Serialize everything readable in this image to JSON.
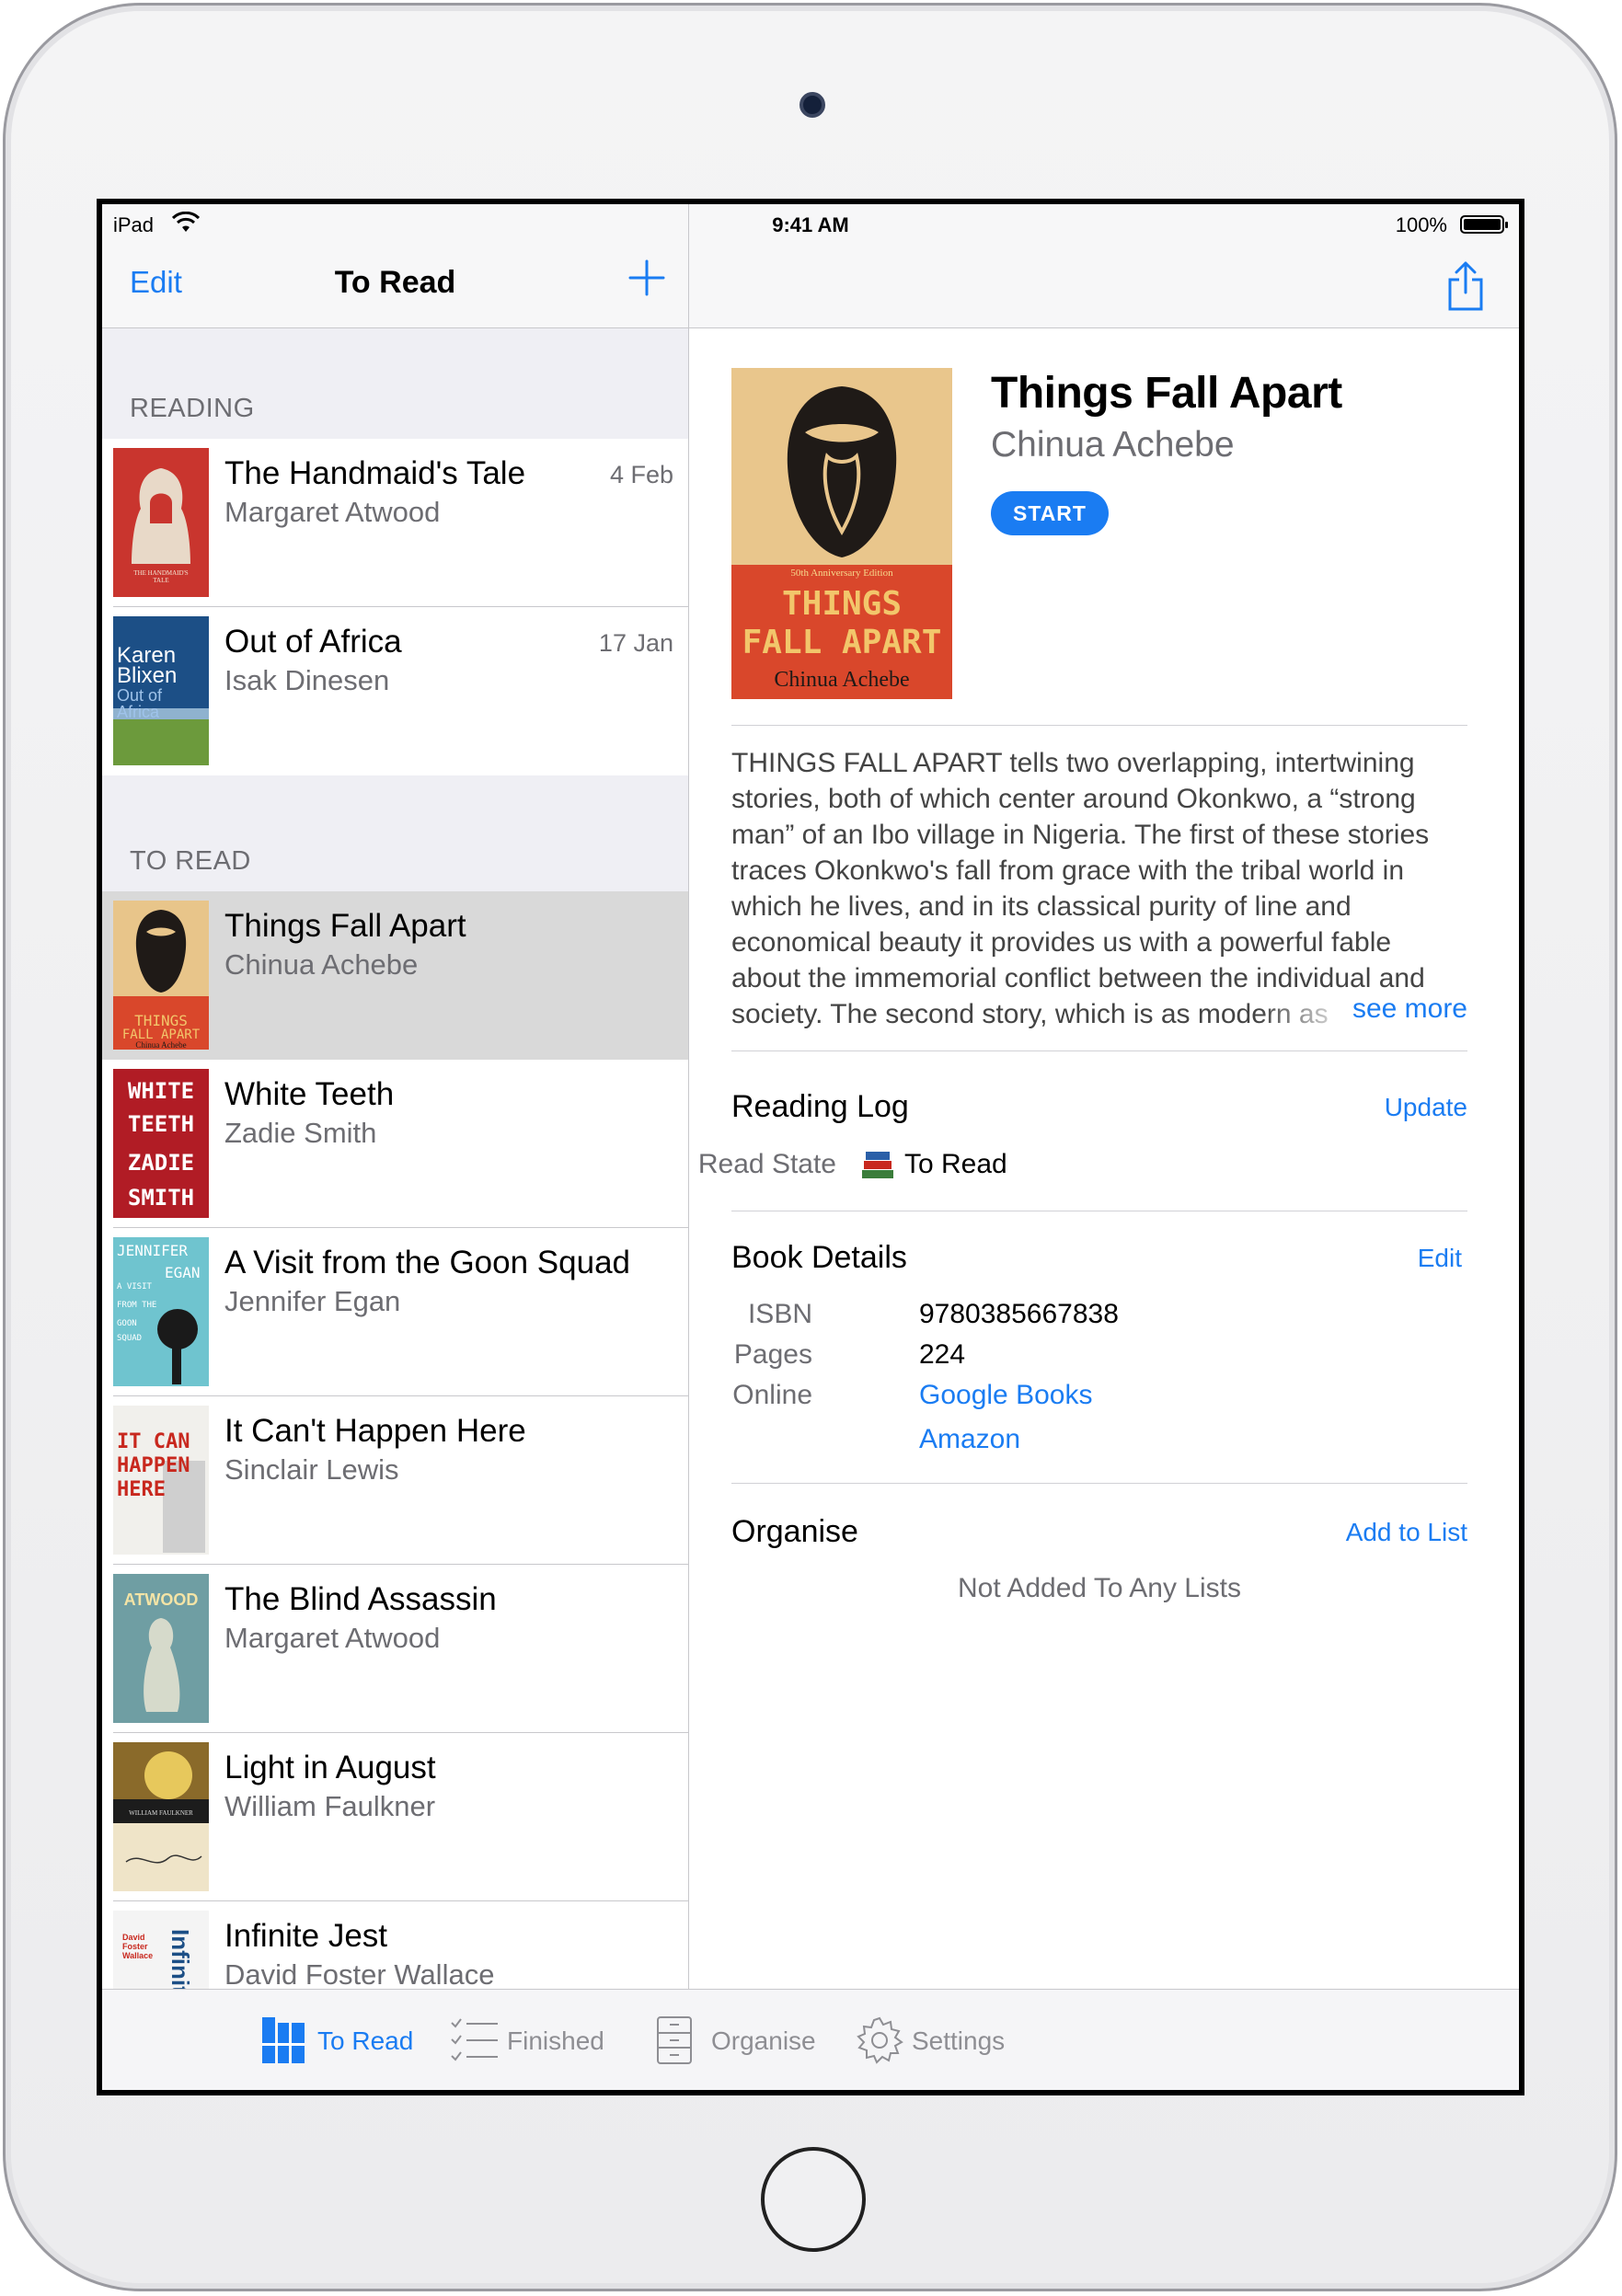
{
  "status_bar": {
    "device": "iPad",
    "time": "9:41 AM",
    "battery": "100%"
  },
  "master": {
    "nav": {
      "edit": "Edit",
      "title": "To Read",
      "add_icon": "plus-icon"
    },
    "sections": {
      "reading": "READING",
      "to_read": "TO READ"
    },
    "reading_books": [
      {
        "title": "The Handmaid's Tale",
        "author": "Margaret Atwood",
        "date": "4 Feb",
        "cover_text": "THE HANDMAID'S TALE"
      },
      {
        "title": "Out of Africa",
        "author": "Isak Dinesen",
        "date": "17 Jan",
        "cover_text": "Karen Blixen Out of Africa"
      }
    ],
    "to_read_books": [
      {
        "title": "Things Fall Apart",
        "author": "Chinua Achebe",
        "cover_text": "THINGS FALL APART",
        "cover_sub": "Chinua Achebe"
      },
      {
        "title": "White Teeth",
        "author": "Zadie Smith",
        "cover_text": "WHITE TEETH ZADIE SMITH"
      },
      {
        "title": "A Visit from the Goon Squad",
        "author": "Jennifer Egan",
        "cover_text": "JENNIFER EGAN A VISIT FROM THE GOON SQUAD"
      },
      {
        "title": "It Can't Happen Here",
        "author": "Sinclair Lewis",
        "cover_text": "IT CAN'T HAPPEN HERE"
      },
      {
        "title": "The Blind Assassin",
        "author": "Margaret Atwood",
        "cover_text": "MARGARET ATWOOD"
      },
      {
        "title": "Light in August",
        "author": "William Faulkner",
        "cover_text": "WILLIAM FAULKNER"
      },
      {
        "title": "Infinite Jest",
        "author": "David Foster Wallace",
        "cover_text": "David Foster Wallace Infinite Jest"
      }
    ]
  },
  "detail": {
    "title": "Things Fall Apart",
    "author": "Chinua Achebe",
    "start_button": "START",
    "cover": {
      "edition": "50th Anniversary Edition",
      "title_line1": "THINGS",
      "title_line2": "FALL APART",
      "author": "Chinua Achebe"
    },
    "description": "THINGS FALL APART tells two overlapping, intertwining stories, both of which center around Okonkwo, a “strong man” of an Ibo village in Nigeria. The first of these stories traces Okonkwo's fall from grace with the tribal world in which he lives, and in its classical purity of line and economical beauty it provides us with a powerful fable about the immemorial conflict between the individual and society. The second story, which is as modern as",
    "see_more": "see more",
    "reading_log": {
      "title": "Reading Log",
      "action": "Update",
      "read_state_label": "Read State",
      "read_state_value": "To Read",
      "read_state_icon": "books-icon"
    },
    "book_details": {
      "title": "Book Details",
      "action": "Edit",
      "isbn_label": "ISBN",
      "isbn": "9780385667838",
      "pages_label": "Pages",
      "pages": "224",
      "online_label": "Online",
      "link_google": "Google Books",
      "link_amazon": "Amazon"
    },
    "organise": {
      "title": "Organise",
      "action": "Add to List",
      "empty_text": "Not Added To Any Lists"
    }
  },
  "tabbar": {
    "tabs": [
      {
        "label": "To Read",
        "icon": "books-shelf-icon",
        "active": true
      },
      {
        "label": "Finished",
        "icon": "checklist-icon",
        "active": false
      },
      {
        "label": "Organise",
        "icon": "cabinet-icon",
        "active": false
      },
      {
        "label": "Settings",
        "icon": "gear-icon",
        "active": false
      }
    ]
  },
  "colors": {
    "accent": "#1a7cf2",
    "secondary_text": "#6d6d72",
    "selected_row": "#d9d9d9",
    "group_bg": "#efeff4"
  }
}
